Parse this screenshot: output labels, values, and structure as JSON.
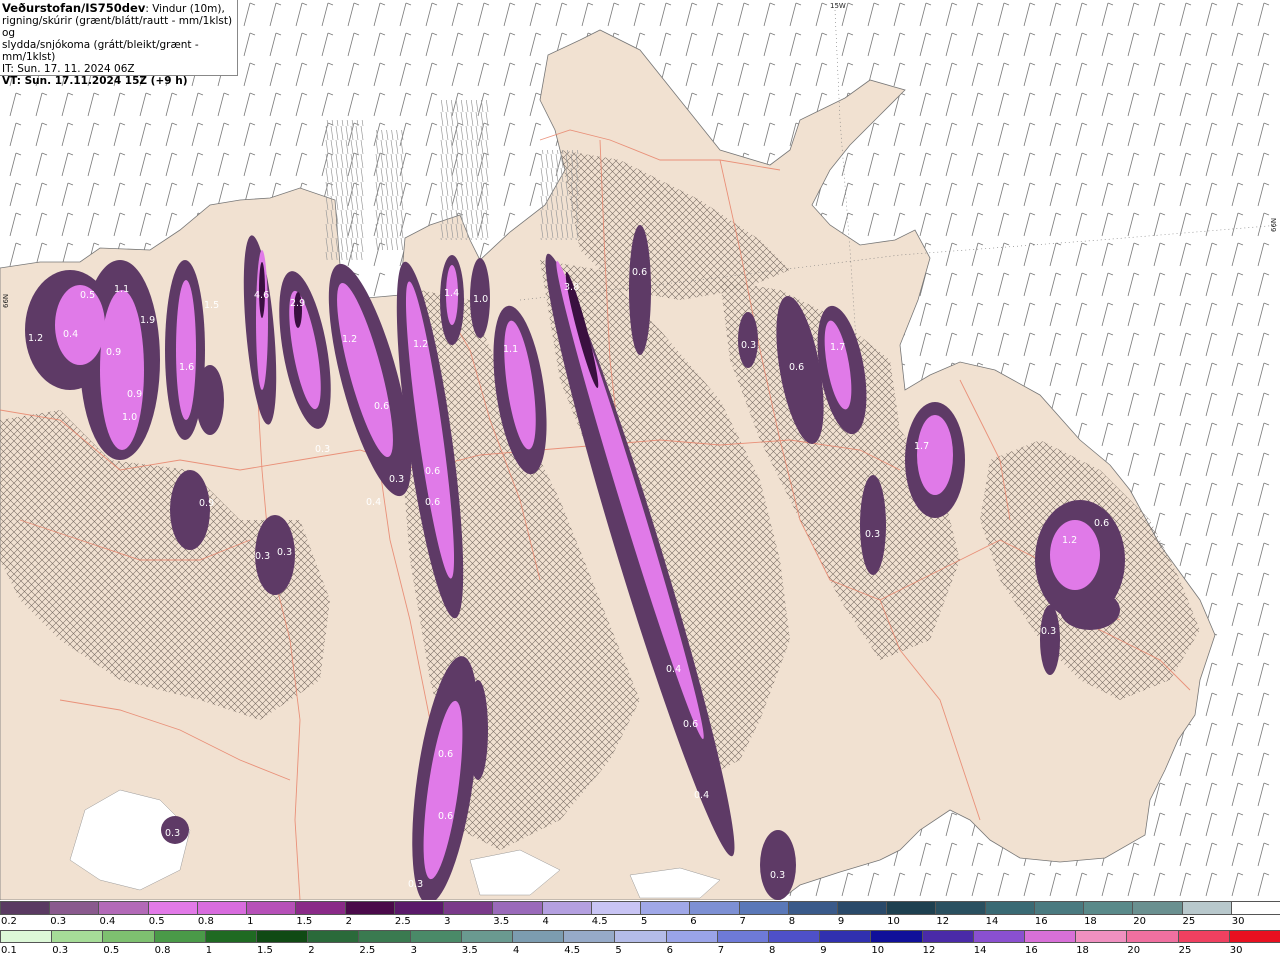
{
  "header": {
    "source": "Veðurstofan/IS750dev",
    "description_line1": ": Vindur (10m),",
    "description_line2": "rigning/skúrir (grænt/blátt/rautt - mm/1klst) og",
    "description_line3": "slydda/snjókoma (grátt/bleikt/grænt - mm/1klst)",
    "it_line": "IT: Sun. 17. 11. 2024 06Z",
    "vt_line": "VT: Sun. 17.11.2024 15Z (+9 h)"
  },
  "graticule": {
    "lon_label": "15W",
    "lat_label_right": "66N",
    "lat_label_left": "66N"
  },
  "snow_scale": {
    "labels": [
      "0.2",
      "0.3",
      "0.4",
      "0.5",
      "0.8",
      "1",
      "1.5",
      "2",
      "2.5",
      "3",
      "3.5",
      "4",
      "4.5",
      "5",
      "6",
      "7",
      "8",
      "9",
      "10",
      "12",
      "14",
      "16",
      "18",
      "20",
      "25",
      "30"
    ],
    "colors": [
      "#5a3a62",
      "#8a5a8e",
      "#b36ab8",
      "#e27ae8",
      "#d86cde",
      "#b650b8",
      "#8a2a88",
      "#4a0a4a",
      "#5a1a6a",
      "#7a3a8a",
      "#9a6aba",
      "#b4a0e0",
      "#c8c4f4",
      "#a0a8e8",
      "#7d90d4",
      "#5a78b8",
      "#3a5a8a",
      "#2a4a6a",
      "#1e4050",
      "#2a5060",
      "#3a6a74",
      "#4a7a80",
      "#5a8a8a",
      "#6a9090",
      "#b8c8cc",
      "#ffffff"
    ]
  },
  "rain_scale": {
    "labels": [
      "0.1",
      "0.3",
      "0.5",
      "0.8",
      "1",
      "1.5",
      "2",
      "2.5",
      "3",
      "3.5",
      "4",
      "4.5",
      "5",
      "6",
      "7",
      "8",
      "9",
      "10",
      "12",
      "14",
      "16",
      "18",
      "20",
      "25",
      "30"
    ],
    "colors": [
      "#ddf8d8",
      "#a6dc98",
      "#7ec070",
      "#4a9a48",
      "#1f6a22",
      "#104a14",
      "#2a6a3a",
      "#3a7a50",
      "#4a8a68",
      "#6a9a90",
      "#7c9cb0",
      "#96aac8",
      "#b4bce8",
      "#9aa4e8",
      "#6e7ad8",
      "#4e50c8",
      "#3030b0",
      "#10109a",
      "#4a2aa8",
      "#8a50d0",
      "#d870d8",
      "#f090c0",
      "#f070a0",
      "#f04060",
      "#e81020"
    ]
  },
  "map_values": [
    {
      "label": "1.2"
    },
    {
      "label": "0.4"
    },
    {
      "label": "0.5"
    },
    {
      "label": "1.1"
    },
    {
      "label": "0.9"
    },
    {
      "label": "1.9"
    },
    {
      "label": "1.6"
    },
    {
      "label": "0.9"
    },
    {
      "label": "1.0"
    },
    {
      "label": "0.9"
    },
    {
      "label": "4.6"
    },
    {
      "label": "2.9"
    },
    {
      "label": "1.5"
    },
    {
      "label": "1.2"
    },
    {
      "label": "1.2"
    },
    {
      "label": "1.4"
    },
    {
      "label": "1.0"
    },
    {
      "label": "1.1"
    },
    {
      "label": "3.8"
    },
    {
      "label": "0.6"
    },
    {
      "label": "0.3"
    },
    {
      "label": "0.6"
    },
    {
      "label": "1.7"
    },
    {
      "label": "1.7"
    },
    {
      "label": "0.3"
    },
    {
      "label": "1.2"
    },
    {
      "label": "0.6"
    },
    {
      "label": "0.3"
    },
    {
      "label": "0.3"
    },
    {
      "label": "0.3"
    },
    {
      "label": "0.3"
    },
    {
      "label": "0.6"
    },
    {
      "label": "0.6"
    },
    {
      "label": "0.6"
    },
    {
      "label": "0.4"
    },
    {
      "label": "0.3"
    },
    {
      "label": "0.4"
    },
    {
      "label": "0.6"
    },
    {
      "label": "0.4"
    },
    {
      "label": "0.6"
    },
    {
      "label": "0.6"
    },
    {
      "label": "0.3"
    },
    {
      "label": "0.3"
    },
    {
      "label": "0.3"
    }
  ]
}
